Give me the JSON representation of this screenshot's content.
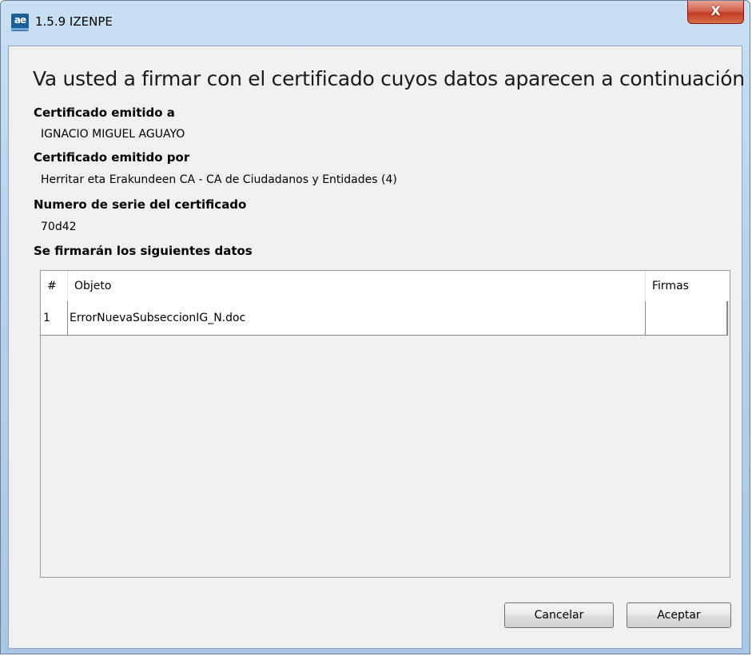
{
  "window": {
    "title": "1.5.9 IZENPE",
    "app_icon_text": "ae",
    "close_label": "X"
  },
  "dialog": {
    "heading": "Va usted a firmar con el certificado cuyos datos aparecen a continuación",
    "issued_to_label": "Certificado emitido a",
    "issued_to_value": "IGNACIO MIGUEL AGUAYO",
    "issued_by_label": "Certificado emitido por",
    "issued_by_value": "Herritar eta Erakundeen CA - CA de Ciudadanos y Entidades (4)",
    "serial_label": "Numero de serie del certificado",
    "serial_value": "70d42",
    "data_label": "Se firmarán los siguientes datos"
  },
  "table": {
    "columns": [
      "#",
      "Objeto",
      "Firmas"
    ],
    "rows": [
      [
        "1",
        "ErrorNuevaSubseccionIG_N.doc",
        ""
      ]
    ]
  },
  "buttons": {
    "cancel": "Cancelar",
    "accept": "Aceptar"
  }
}
